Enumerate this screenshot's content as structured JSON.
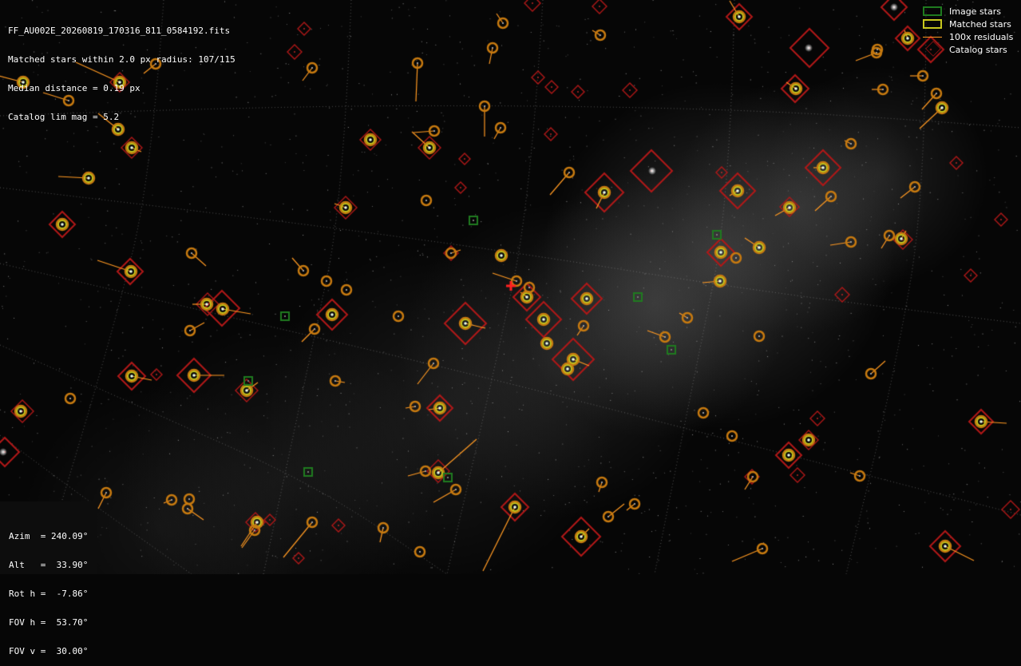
{
  "header": {
    "filename": "FF_AU002E_20260819_170316_811_0584192.fits",
    "matched_line": "Matched stars within 2.0 px radius: 107/115",
    "median_line": "Median distance = 0.19 px",
    "catalog_line": "Catalog lim mag = 5.2"
  },
  "legend": {
    "image_stars": "Image stars",
    "matched_stars": "Matched stars",
    "residuals": "100x residuals",
    "catalog_stars": "Catalog stars"
  },
  "pointing": {
    "azim": "Azim  = 240.09°",
    "alt": "Alt   =  33.90°",
    "rot": "Rot h =  -7.86°",
    "fov_h": "FOV h =  53.70°",
    "fov_v": "FOV v =  30.00°"
  },
  "colors": {
    "background": "#060606",
    "image_star": "#1f7a1f",
    "matched_star": "#c7c71e",
    "residual": "#ff9922",
    "catalog_star": "#b01818",
    "center_marker": "#ff2020"
  }
}
